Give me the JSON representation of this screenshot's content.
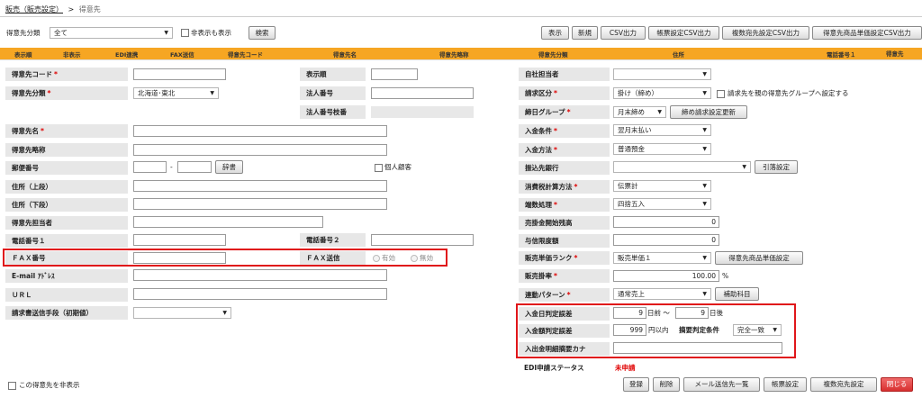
{
  "breadcrumb": {
    "parent": "販売（販売設定）",
    "separator": ">",
    "current": "得意先"
  },
  "toolbar": {
    "category_label": "得意先分類",
    "category_value": "全て",
    "show_hidden_label": "非表示も表示",
    "search_btn": "検索",
    "buttons": [
      "表示",
      "新規",
      "CSV出力",
      "帳票設定CSV出力",
      "複数宛先設定CSV出力",
      "得意先商品単価設定CSV出力"
    ]
  },
  "grid_header": [
    "表示順",
    "非表示",
    "EDI連携",
    "FAX送信",
    "得意先コード",
    "得意先名",
    "得意先略称",
    "得意先分類",
    "住所",
    "電話番号１",
    "得意先"
  ],
  "form": {
    "code": {
      "label": "得意先コード",
      "value": ""
    },
    "display_order": {
      "label": "表示順",
      "value": ""
    },
    "category": {
      "label": "得意先分類",
      "value": "北海道･東北"
    },
    "corp_number": {
      "label": "法人番号",
      "value": ""
    },
    "corp_branch": {
      "label": "法人番号枝番",
      "value": ""
    },
    "name": {
      "label": "得意先名",
      "value": ""
    },
    "short_name": {
      "label": "得意先略称",
      "value": ""
    },
    "postal": {
      "label": "郵便番号",
      "sep": "-",
      "dict_btn": "辞書",
      "individual_label": "個人顧客"
    },
    "address1": {
      "label": "住所（上段）",
      "value": ""
    },
    "address2": {
      "label": "住所（下段）",
      "value": ""
    },
    "contact": {
      "label": "得意先担当者",
      "value": ""
    },
    "phone1": {
      "label": "電話番号１",
      "value": ""
    },
    "phone2": {
      "label": "電話番号２",
      "value": ""
    },
    "fax": {
      "label": "ＦＡＸ番号",
      "value": ""
    },
    "fax_send": {
      "label": "ＦＡＸ送信",
      "opt_on": "有効",
      "opt_off": "無効"
    },
    "email": {
      "label": "E-mail ｱﾄﾞﾚｽ",
      "value": ""
    },
    "url": {
      "label": "ＵＲＬ",
      "value": ""
    },
    "invoice_method": {
      "label": "請求書送信手段（初期値）",
      "value": ""
    }
  },
  "right": {
    "staff": {
      "label": "自社担当者",
      "value": ""
    },
    "billing_type": {
      "label": "請求区分",
      "value": "掛け（締め）",
      "group_label": "請求先を親の得意先グループへ設定する"
    },
    "closing_group": {
      "label": "締日グループ",
      "value": "月末締め",
      "btn": "締め請求設定更新"
    },
    "payment_terms": {
      "label": "入金条件",
      "value": "翌月末払い"
    },
    "payment_method": {
      "label": "入金方法",
      "value": "普通預金"
    },
    "bank": {
      "label": "振込先銀行",
      "value": "",
      "btn": "引落設定"
    },
    "tax_calc": {
      "label": "消費税計算方法",
      "value": "伝票計"
    },
    "rounding": {
      "label": "端数処理",
      "value": "四捨五入"
    },
    "ar_opening": {
      "label": "売掛金開始残高",
      "value": "0"
    },
    "credit_limit": {
      "label": "与信限度額",
      "value": "0"
    },
    "price_rank": {
      "label": "販売単価ランク",
      "value": "販売単価１",
      "btn": "得意先商品単価設定"
    },
    "sales_rate": {
      "label": "販売掛率",
      "value": "100.00",
      "unit": "%"
    },
    "link_pattern": {
      "label": "連動パターン",
      "value": "通常売上",
      "btn": "補助科目"
    },
    "date_tolerance": {
      "label": "入金日判定誤差",
      "before": "9",
      "before_unit": "日前",
      "tilde": "～",
      "after": "9",
      "after_unit": "日後"
    },
    "amount_tolerance": {
      "label": "入金額判定誤差",
      "value": "999",
      "unit": "円以内",
      "summary_label": "摘要判定条件",
      "summary_value": "完全一致"
    },
    "detail_kana": {
      "label": "入出金明細摘要カナ",
      "value": ""
    },
    "edi_status": {
      "label": "EDI申請ステータス",
      "value": "未申請"
    }
  },
  "footer": {
    "hide_label": "この得意先を非表示",
    "buttons": [
      "登録",
      "削除",
      "メール送信先一覧",
      "帳票設定",
      "複数宛先設定"
    ],
    "close": "閉じる"
  },
  "colors": {
    "highlight": "#e0161a",
    "status_red": "#e00000",
    "label_bg": "#e7e7e7",
    "header_bar": "#f6a623"
  }
}
